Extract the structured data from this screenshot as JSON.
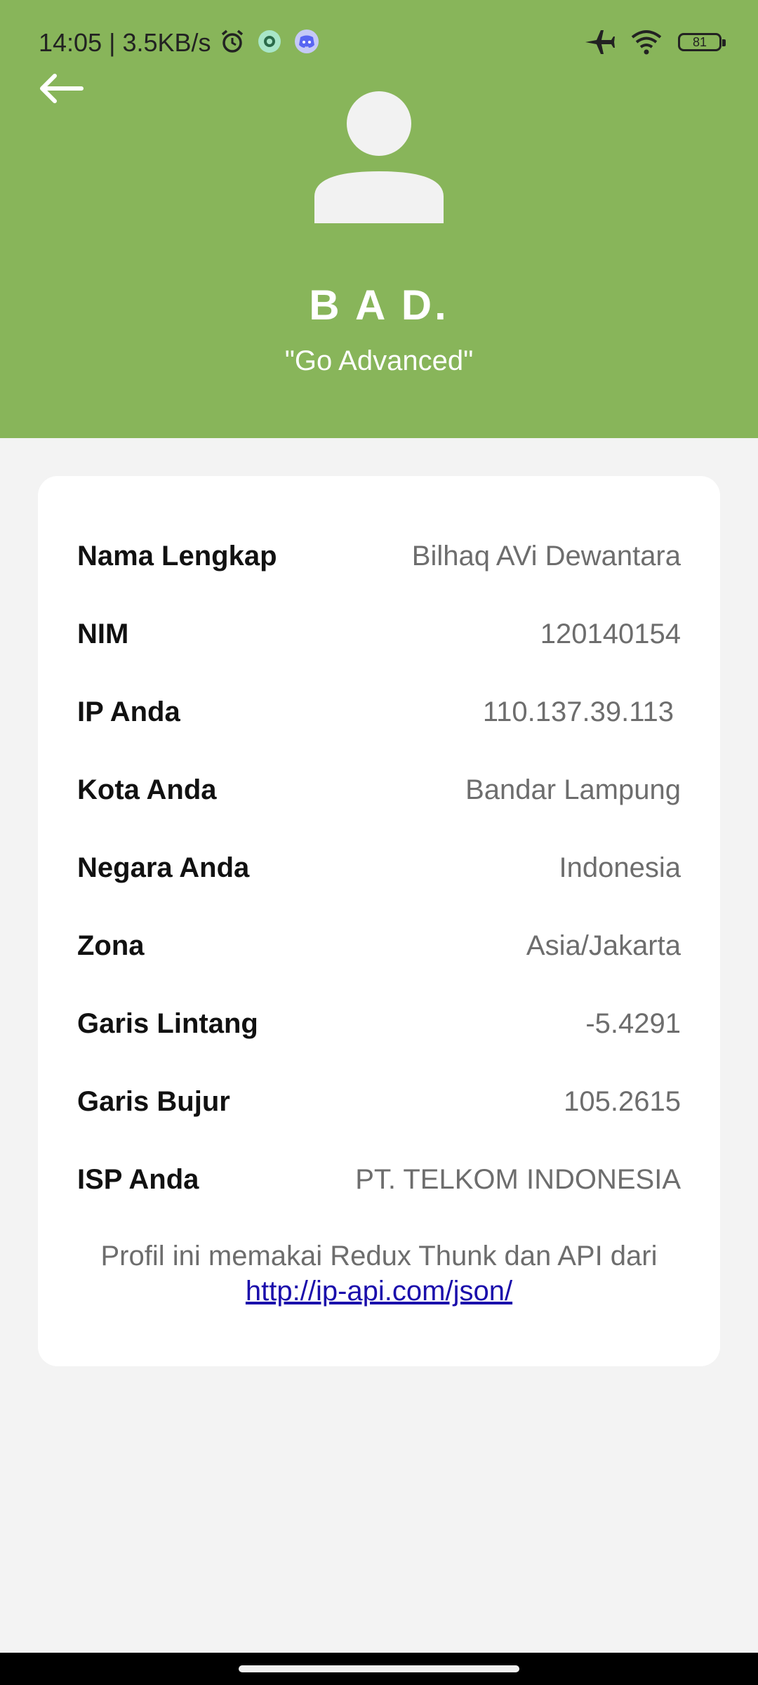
{
  "status_bar": {
    "time_speed": "14:05 | 3.5KB/s",
    "battery": "81"
  },
  "header": {
    "name": "B A D.",
    "tagline": "\"Go Advanced\""
  },
  "profile": {
    "rows": [
      {
        "label": "Nama Lengkap",
        "value": "Bilhaq AVi Dewantara"
      },
      {
        "label": "NIM",
        "value": "120140154"
      },
      {
        "label": "IP Anda",
        "value": "110.137.39.113"
      },
      {
        "label": "Kota Anda",
        "value": "Bandar Lampung"
      },
      {
        "label": "Negara Anda",
        "value": "Indonesia"
      },
      {
        "label": "Zona",
        "value": "Asia/Jakarta"
      },
      {
        "label": "Garis Lintang",
        "value": "-5.4291"
      },
      {
        "label": "Garis Bujur",
        "value": "105.2615"
      },
      {
        "label": "ISP Anda",
        "value": "PT. TELKOM INDONESIA"
      }
    ],
    "footer_text": "Profil ini memakai Redux Thunk dan API dari",
    "footer_link": "http://ip-api.com/json/"
  },
  "colors": {
    "header_bg": "#88b55a",
    "page_bg": "#f3f3f3",
    "link": "#1a0dab"
  }
}
